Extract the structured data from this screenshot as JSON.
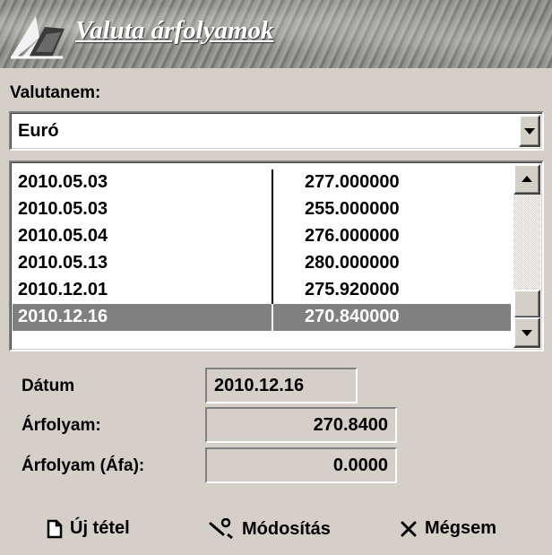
{
  "banner": {
    "title": "Valuta árfolyamok",
    "logo_icon": "book-logo-icon"
  },
  "currency": {
    "label": "Valutanem:",
    "selected": "Euró"
  },
  "rates": {
    "rows": [
      {
        "date": "2010.05.03",
        "rate": "277.000000"
      },
      {
        "date": "2010.05.03",
        "rate": "255.000000"
      },
      {
        "date": "2010.05.04",
        "rate": "276.000000"
      },
      {
        "date": "2010.05.13",
        "rate": "280.000000"
      },
      {
        "date": "2010.12.01",
        "rate": "275.920000"
      },
      {
        "date": "2010.12.16",
        "rate": "270.840000"
      }
    ],
    "selected_index": 5
  },
  "details": {
    "date_label": "Dátum",
    "date_value": "2010.12.16",
    "rate_label": "Árfolyam:",
    "rate_value": "270.8400",
    "vat_rate_label": "Árfolyam (Áfa):",
    "vat_rate_value": "0.0000"
  },
  "actions": {
    "new": {
      "label": "Új tétel",
      "icon": "new-document-icon"
    },
    "modify": {
      "label": "Módosítás",
      "icon": "wrench-icon"
    },
    "cancel": {
      "label": "Mégsem",
      "icon": "close-icon"
    }
  },
  "colors": {
    "window_bg": "#d4d0c8",
    "selection_bg": "#808080",
    "selection_fg": "#ffffff"
  }
}
